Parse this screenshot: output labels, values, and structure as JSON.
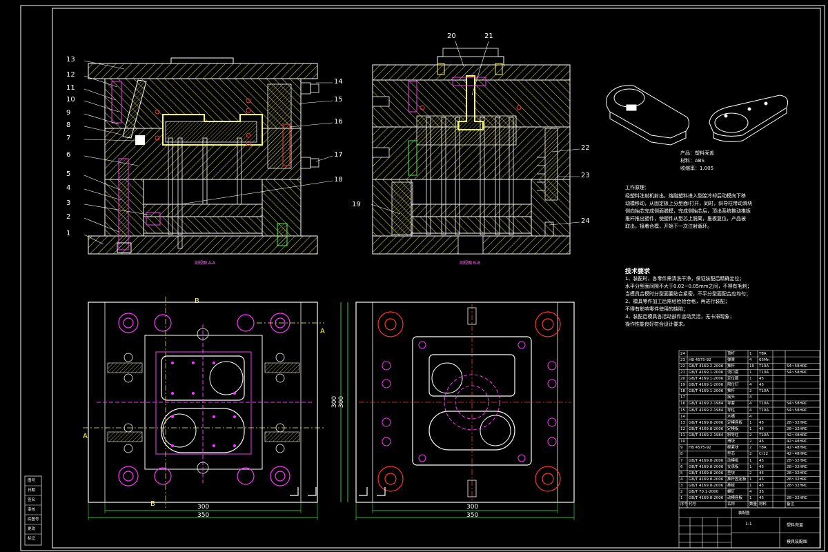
{
  "drawing": {
    "colors": {
      "background": "#000000",
      "outline": "#ffffff",
      "hatch_steel": "#c8c85a",
      "hatch_plate": "#b8b850",
      "pink": "#ff33ff",
      "red": "#ff3333",
      "cyan": "#00e0e0",
      "green": "#40ff40",
      "yellow": "#ffff40"
    }
  },
  "views": {
    "section_a_label": "剖视图 A-A",
    "section_b_label": "剖视图 B-B",
    "dim_width_1": "300",
    "dim_total_1": "350",
    "dim_width_2": "300",
    "dim_total_2": "350",
    "dim_height_1": "300",
    "dim_height_2": "300",
    "cut_a_top": "A",
    "cut_a_bottom": "A",
    "cut_b_top": "B",
    "cut_b_bottom": "B"
  },
  "part_numbers_left": [
    "13",
    "12",
    "11",
    "10",
    "9",
    "8",
    "7",
    "6",
    "5",
    "4",
    "3",
    "2",
    "1"
  ],
  "part_numbers_right_a": [
    "14",
    "15",
    "16",
    "17",
    "18"
  ],
  "part_numbers_b": [
    "20",
    "21",
    "22",
    "23",
    "24",
    "19"
  ],
  "product": {
    "name": "产品：塑料壳盖",
    "material": "材料：ABS",
    "shrink": "收缩率：1.005"
  },
  "working_principle": {
    "heading": "工作原理：",
    "lines": [
      "经塑料注射机射出，熔融塑料进入型腔冷却后动模向下移",
      "动模移动，从固定板上分型面I打开，同时，斜导柱带动滑块",
      "侧向抽芯完成侧面脱模，完成侧抽芯后，顶出系统推动推板",
      "推杆推出塑件，使塑件从型芯上脱离，推板复位，产品被",
      "取出，接着合模，开始下一次注射循环。"
    ]
  },
  "tech_requirements": {
    "heading": "技术要求",
    "lines": [
      "1、装配时，各零件需清洗干净，保证装配后精确定位；",
      "水平分型面间隙不大于0.02~0.05mm之间，不得有毛刺；",
      "当模具合模时分型面要贴合紧密，不平分型面配合应均匀；",
      "2、模具零件加工后需经检验合格，再进行装配；",
      "不得有影响零件使用的缺陷；",
      "3、装配后模具各活动部件运动灵活，无卡滞现象；",
      "操作性能良好符合设计要求。"
    ]
  },
  "bom_rows": [
    {
      "no": "24",
      "code": "",
      "name": "顶杆",
      "qty": "1",
      "mat": "T8A",
      "note": ""
    },
    {
      "no": "23",
      "code": "HB 4575-92",
      "name": "弹簧",
      "qty": "4",
      "mat": "65Mn",
      "note": ""
    },
    {
      "no": "22",
      "code": "GB/T 4169.2-2006",
      "name": "推杆",
      "qty": "10",
      "mat": "T10A",
      "note": "54~58HRC"
    },
    {
      "no": "21",
      "code": "GB/T 4169.1-2006",
      "name": "浇口套",
      "qty": "1",
      "mat": "T10A",
      "note": "54~58HRC"
    },
    {
      "no": "20",
      "code": "GB/T 4169.1-2006",
      "name": "定位圈",
      "qty": "1",
      "mat": "45",
      "note": ""
    },
    {
      "no": "19",
      "code": "GB/T 4169.1-2006",
      "name": "限位钉",
      "qty": "4",
      "mat": "45",
      "note": ""
    },
    {
      "no": "18",
      "code": "GB/T 4169.1-2006",
      "name": "推杆",
      "qty": "2",
      "mat": "T10A",
      "note": ""
    },
    {
      "no": "17",
      "code": "",
      "name": "接头",
      "qty": "4",
      "mat": "",
      "note": ""
    },
    {
      "no": "16",
      "code": "GB/T 4169.2-1984",
      "name": "导套",
      "qty": "4",
      "mat": "T10A",
      "note": "54~58HRC"
    },
    {
      "no": "15",
      "code": "GB/T 4169.2-1984",
      "name": "导柱",
      "qty": "4",
      "mat": "T10A",
      "note": "54~58HRC"
    },
    {
      "no": "14",
      "code": "",
      "name": "水嘴",
      "qty": "4",
      "mat": "",
      "note": ""
    },
    {
      "no": "13",
      "code": "GB/T 4169.8-2006",
      "name": "定模座板",
      "qty": "1",
      "mat": "45",
      "note": "28~32HRC"
    },
    {
      "no": "12",
      "code": "GB/T 4169.8-2006",
      "name": "定模板",
      "qty": "1",
      "mat": "45",
      "note": "28~32HRC"
    },
    {
      "no": "11",
      "code": "GB/T 4169.2-1984",
      "name": "斜导柱",
      "qty": "2",
      "mat": "T10A",
      "note": "42~48HRC"
    },
    {
      "no": "10",
      "code": "",
      "name": "滑块",
      "qty": "2",
      "mat": "45",
      "note": "42~48HRC"
    },
    {
      "no": "9",
      "code": "HB 4575-92",
      "name": "楔紧块",
      "qty": "2",
      "mat": "T8A",
      "note": "42~48HRC"
    },
    {
      "no": "8",
      "code": "",
      "name": "型芯",
      "qty": "2",
      "mat": "Cr12",
      "note": "42~48HRC"
    },
    {
      "no": "7",
      "code": "GB/T 4169.8-2006",
      "name": "动模板",
      "qty": "1",
      "mat": "45",
      "note": "28~32HRC"
    },
    {
      "no": "6",
      "code": "GB/T 4169.8-2006",
      "name": "支承板",
      "qty": "1",
      "mat": "45",
      "note": "28~32HRC"
    },
    {
      "no": "5",
      "code": "GB/T 4169.8-2006",
      "name": "垫块",
      "qty": "2",
      "mat": "45",
      "note": "28~32HRC"
    },
    {
      "no": "4",
      "code": "GB/T 4169.8-2006",
      "name": "推杆固定板",
      "qty": "1",
      "mat": "45",
      "note": "28~32HRC"
    },
    {
      "no": "3",
      "code": "GB/T 4169.8-2006",
      "name": "推板",
      "qty": "1",
      "mat": "45",
      "note": "28~32HRC"
    },
    {
      "no": "2",
      "code": "GB/T 70.1-2000",
      "name": "螺钉",
      "qty": "4",
      "mat": "35",
      "note": ""
    },
    {
      "no": "1",
      "code": "GB/T 4169.8-2006",
      "name": "动模座板",
      "qty": "1",
      "mat": "45",
      "note": "28~32HRC"
    }
  ],
  "bom_header": {
    "no": "序号",
    "code": "代号",
    "name": "名称",
    "qty": "数量",
    "mat": "材料",
    "note": "备注"
  },
  "title_block": {
    "project": "塑料壳盖",
    "drawing_name": "模具装配图",
    "scale": "1:1",
    "assembly_label": "装配图"
  },
  "left_strip": [
    "图号",
    "日期",
    "签名",
    "审核",
    "底图号",
    "更改",
    "标记"
  ]
}
